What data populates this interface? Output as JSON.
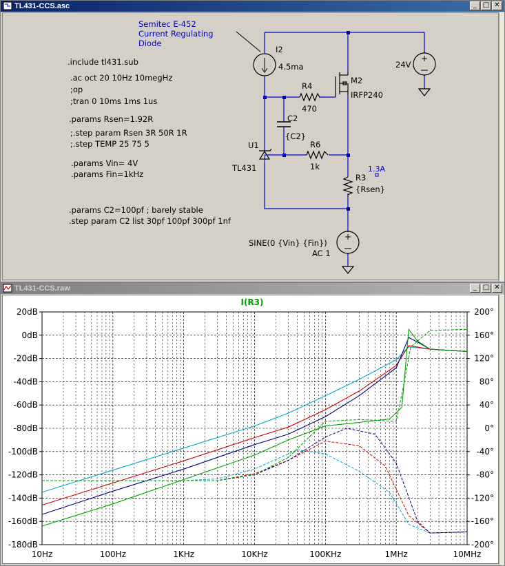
{
  "schematic_window": {
    "title": "TL431-CCS.asc",
    "buttons": {
      "minimize": "_",
      "maximize": "□",
      "close": "✕"
    },
    "directives": [
      ".include tl431.sub",
      ".ac oct 20 10Hz 10megHz",
      ";op",
      ";tran 0 10ms 1ms 1us",
      ".params Rsen=1.92R",
      ";.step param Rsen 3R 50R 1R",
      ";.step TEMP 25 75 5",
      ".params Vin= 4V",
      ".params Fin=1kHz",
      ".params C2=100pf ; barely stable",
      ".step param C2 list  30pf 100pf  300pf 1nf"
    ],
    "annotation": [
      "Semitec E-452",
      "Current Regulating",
      "Diode"
    ],
    "components": {
      "i2_name": "I2",
      "i2_value": "4.5ma",
      "m2_name": "M2",
      "m2_value": "IRFP240",
      "r4_name": "R4",
      "r4_value": "470",
      "c2_name": "C2",
      "c2_value": "{C2}",
      "u1_name": "U1",
      "u1_value": "TL431",
      "r6_name": "R6",
      "r6_value": "1k",
      "r3_name": "R3",
      "r3_value": "{Rsen}",
      "r3_current": "1.3A",
      "v_supply": "24V",
      "v_source_1": "SINE(0 {Vin} {Fin})",
      "v_source_2": "AC 1"
    }
  },
  "plot_window": {
    "title": "TL431-CCS.raw",
    "buttons": {
      "minimize": "_",
      "maximize": "□",
      "close": "✕"
    },
    "trace_label": "I(R3)"
  },
  "colors": {
    "schematic_wire": "#0000cc",
    "directive_text": "#000000",
    "annotation_text": "#0000cc",
    "trace_label": "#00a000",
    "series_cyan": "#00a8c8",
    "series_red": "#d00000",
    "series_navy": "#000080",
    "series_green": "#00a000"
  },
  "chart_data": {
    "type": "line",
    "title": "I(R3)",
    "x_scale": "log",
    "x_ticks": [
      "10Hz",
      "100Hz",
      "1KHz",
      "10KHz",
      "100KHz",
      "1MHz",
      "10MHz"
    ],
    "x_values": [
      10,
      100,
      1000,
      10000,
      100000,
      1000000,
      10000000
    ],
    "xlim": [
      10,
      10000000
    ],
    "y_left_ticks": [
      "20dB",
      "0dB",
      "-20dB",
      "-40dB",
      "-60dB",
      "-80dB",
      "-100dB",
      "-120dB",
      "-140dB",
      "-160dB",
      "-180dB"
    ],
    "ylim_left": [
      -180,
      20
    ],
    "y_right_ticks": [
      "200°",
      "160°",
      "120°",
      "80°",
      "40°",
      "0°",
      "-40°",
      "-80°",
      "-120°",
      "-160°",
      "-200°"
    ],
    "ylim_right": [
      -200,
      200
    ],
    "grid": true,
    "series": [
      {
        "color": "#00a8c8",
        "magnitude_db": [
          [
            10,
            -135
          ],
          [
            100,
            -116
          ],
          [
            1000,
            -97
          ],
          [
            10000,
            -78
          ],
          [
            30000,
            -67
          ],
          [
            100000,
            -52
          ],
          [
            300000,
            -38
          ],
          [
            1000000,
            -21
          ],
          [
            1500000,
            -10
          ],
          [
            3000000,
            -12
          ],
          [
            10000000,
            -14
          ]
        ],
        "phase_deg": [
          [
            10,
            -90
          ],
          [
            1000,
            -90
          ],
          [
            3000,
            -87
          ],
          [
            10000,
            -70
          ],
          [
            40000,
            -37
          ],
          [
            100000,
            -44
          ],
          [
            300000,
            -74
          ],
          [
            800000,
            -110
          ],
          [
            1500000,
            -165
          ],
          [
            3000000,
            -180
          ],
          [
            10000000,
            -178
          ]
        ]
      },
      {
        "color": "#d00000",
        "magnitude_db": [
          [
            10,
            -146
          ],
          [
            100,
            -127
          ],
          [
            1000,
            -108
          ],
          [
            10000,
            -88
          ],
          [
            30000,
            -79
          ],
          [
            100000,
            -64
          ],
          [
            300000,
            -48
          ],
          [
            1000000,
            -26
          ],
          [
            1500000,
            -9
          ],
          [
            3000000,
            -12
          ],
          [
            10000000,
            -14
          ]
        ],
        "phase_deg": [
          [
            10,
            -90
          ],
          [
            3000,
            -90
          ],
          [
            10000,
            -78
          ],
          [
            30000,
            -55
          ],
          [
            100000,
            -22
          ],
          [
            300000,
            -30
          ],
          [
            700000,
            -65
          ],
          [
            1500000,
            -150
          ],
          [
            3000000,
            -180
          ],
          [
            10000000,
            -178
          ]
        ]
      },
      {
        "color": "#000080",
        "magnitude_db": [
          [
            10,
            -154
          ],
          [
            100,
            -134
          ],
          [
            1000,
            -115
          ],
          [
            10000,
            -94
          ],
          [
            30000,
            -85
          ],
          [
            100000,
            -70
          ],
          [
            300000,
            -52
          ],
          [
            1000000,
            -28
          ],
          [
            1500000,
            -2
          ],
          [
            2000000,
            -6
          ],
          [
            3000000,
            -12
          ],
          [
            10000000,
            -14
          ]
        ],
        "phase_deg": [
          [
            10,
            -90
          ],
          [
            3000,
            -90
          ],
          [
            10000,
            -80
          ],
          [
            30000,
            -55
          ],
          [
            100000,
            -15
          ],
          [
            200000,
            0
          ],
          [
            500000,
            -10
          ],
          [
            1000000,
            -60
          ],
          [
            2000000,
            -160
          ],
          [
            3000000,
            -180
          ],
          [
            10000000,
            -178
          ]
        ]
      },
      {
        "color": "#00a000",
        "magnitude_db": [
          [
            10,
            -164
          ],
          [
            100,
            -145
          ],
          [
            1000,
            -124
          ],
          [
            10000,
            -103
          ],
          [
            30000,
            -90
          ],
          [
            100000,
            -78
          ],
          [
            300000,
            -75
          ],
          [
            800000,
            -72
          ],
          [
            1200000,
            -62
          ],
          [
            1500000,
            5
          ],
          [
            2000000,
            -5
          ],
          [
            3000000,
            -12
          ],
          [
            10000000,
            -14
          ]
        ],
        "phase_deg": [
          [
            10,
            -90
          ],
          [
            3000,
            -90
          ],
          [
            10000,
            -80
          ],
          [
            30000,
            -50
          ],
          [
            100000,
            12
          ],
          [
            300000,
            15
          ],
          [
            1000000,
            12
          ],
          [
            1300000,
            80
          ],
          [
            1600000,
            140
          ],
          [
            3000000,
            168
          ],
          [
            10000000,
            170
          ]
        ]
      }
    ]
  }
}
